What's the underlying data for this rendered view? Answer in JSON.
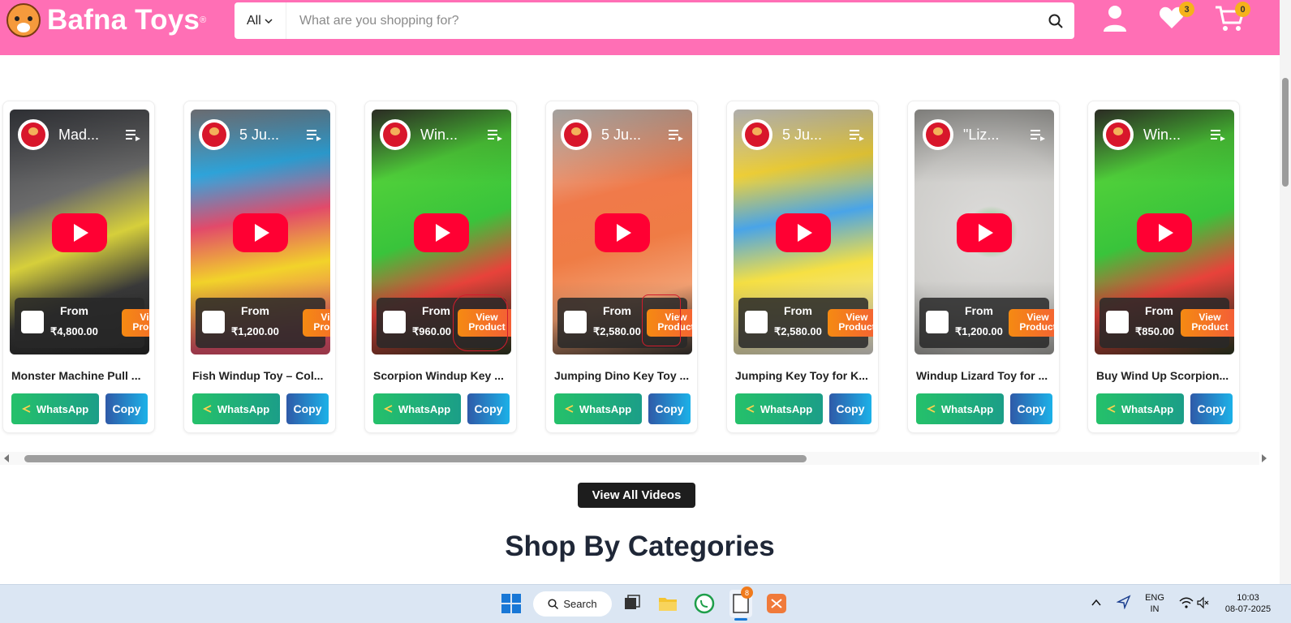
{
  "header": {
    "brand": "Bafna Toys",
    "registered": "®",
    "search_category": "All",
    "search_placeholder": "What are you shopping for?",
    "wishlist_count": "3",
    "cart_count": "0"
  },
  "videos": [
    {
      "title": "Mad...",
      "from": "From",
      "price": "₹4,800.00",
      "view": "View Product",
      "name": "Monster Machine Pull ...",
      "whatsapp": "WhatsApp",
      "copy": "Copy"
    },
    {
      "title": "5 Ju...",
      "from": "From",
      "price": "₹1,200.00",
      "view": "View Product",
      "name": "Fish Windup Toy – Col...",
      "whatsapp": "WhatsApp",
      "copy": "Copy"
    },
    {
      "title": "Win...",
      "from": "From",
      "price": "₹960.00",
      "view": "View Product",
      "name": "Scorpion Windup Key ...",
      "whatsapp": "WhatsApp",
      "copy": "Copy"
    },
    {
      "title": "5 Ju...",
      "from": "From",
      "price": "₹2,580.00",
      "view": "View Product",
      "name": "Jumping Dino Key Toy ...",
      "whatsapp": "WhatsApp",
      "copy": "Copy"
    },
    {
      "title": "5 Ju...",
      "from": "From",
      "price": "₹2,580.00",
      "view": "View Product",
      "name": "Jumping Key Toy for K...",
      "whatsapp": "WhatsApp",
      "copy": "Copy"
    },
    {
      "title": "\"Liz...",
      "from": "From",
      "price": "₹1,200.00",
      "view": "View Product",
      "name": "Windup Lizard Toy for ...",
      "whatsapp": "WhatsApp",
      "copy": "Copy"
    },
    {
      "title": "Win...",
      "from": "From",
      "price": "₹850.00",
      "view": "View Product",
      "name": "Buy Wind Up Scorpion...",
      "whatsapp": "WhatsApp",
      "copy": "Copy"
    }
  ],
  "view_all_label": "View All Videos",
  "section_title": "Shop By Categories",
  "taskbar": {
    "search_label": "Search",
    "lang_top": "ENG",
    "lang_bottom": "IN",
    "time": "10:03",
    "date": "08-07-2025",
    "notif_badge": "8"
  },
  "colors": {
    "header_bg": "#ff6fb5",
    "whatsapp": "#25c16a",
    "copy": "#2f5aa8",
    "view_product": "#f58a12",
    "play": "#ff0033"
  }
}
